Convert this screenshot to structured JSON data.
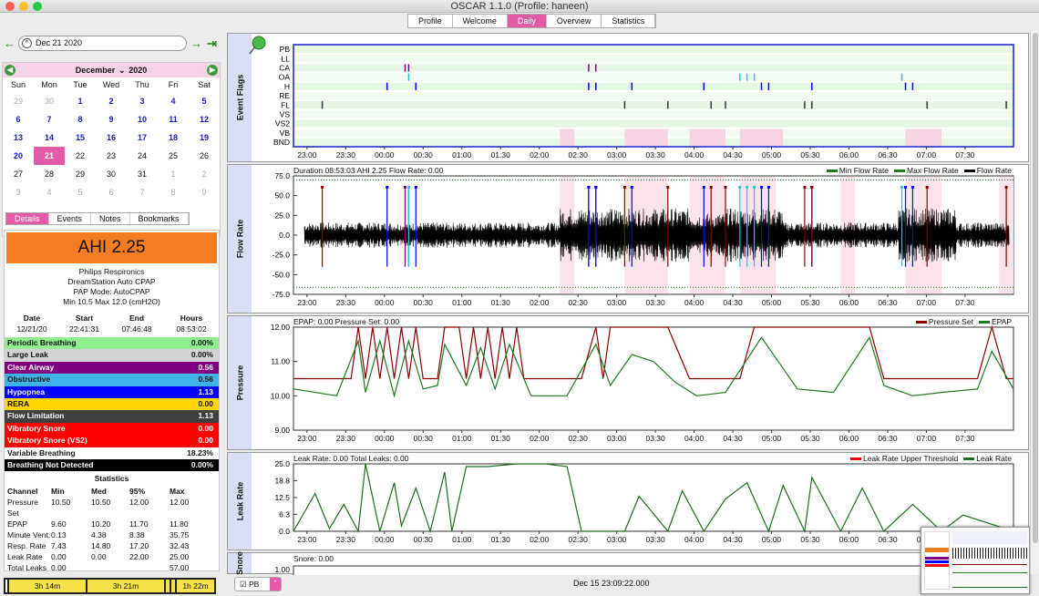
{
  "window": {
    "title": "OSCAR 1.1.0 (Profile: haneen)"
  },
  "tabs": [
    "Profile",
    "Welcome",
    "Daily",
    "Overview",
    "Statistics"
  ],
  "active_tab": "Daily",
  "nav": {
    "date_value": "Dec 21 2020",
    "prev_icon": "arrow-left-icon",
    "next_icon": "arrow-right-icon",
    "last_icon": "jump-end-icon"
  },
  "calendar": {
    "month": "December",
    "year": "2020",
    "dows": [
      "Sun",
      "Mon",
      "Tue",
      "Wed",
      "Thu",
      "Fri",
      "Sat"
    ],
    "days": [
      {
        "d": "29",
        "c": "out"
      },
      {
        "d": "30",
        "c": "out"
      },
      {
        "d": "1",
        "c": "blue"
      },
      {
        "d": "2",
        "c": "blue"
      },
      {
        "d": "3",
        "c": "blue"
      },
      {
        "d": "4",
        "c": "blue"
      },
      {
        "d": "5",
        "c": "blue"
      },
      {
        "d": "6",
        "c": "blue"
      },
      {
        "d": "7",
        "c": "blue"
      },
      {
        "d": "8",
        "c": "blue"
      },
      {
        "d": "9",
        "c": "blue"
      },
      {
        "d": "10",
        "c": "blue"
      },
      {
        "d": "11",
        "c": "blue"
      },
      {
        "d": "12",
        "c": "blue"
      },
      {
        "d": "13",
        "c": "blue"
      },
      {
        "d": "14",
        "c": "blue"
      },
      {
        "d": "15",
        "c": "blue"
      },
      {
        "d": "16",
        "c": "blue"
      },
      {
        "d": "17",
        "c": "blue"
      },
      {
        "d": "18",
        "c": "blue"
      },
      {
        "d": "19",
        "c": "blue"
      },
      {
        "d": "20",
        "c": "blue"
      },
      {
        "d": "21",
        "c": "sel"
      },
      {
        "d": "22",
        "c": "black"
      },
      {
        "d": "23",
        "c": "black"
      },
      {
        "d": "24",
        "c": "black"
      },
      {
        "d": "25",
        "c": "black"
      },
      {
        "d": "26",
        "c": "black"
      },
      {
        "d": "27",
        "c": "black"
      },
      {
        "d": "28",
        "c": "black"
      },
      {
        "d": "29",
        "c": "black"
      },
      {
        "d": "30",
        "c": "black"
      },
      {
        "d": "31",
        "c": "black"
      },
      {
        "d": "1",
        "c": "out"
      },
      {
        "d": "2",
        "c": "out"
      },
      {
        "d": "3",
        "c": "out"
      },
      {
        "d": "4",
        "c": "out"
      },
      {
        "d": "5",
        "c": "out"
      },
      {
        "d": "6",
        "c": "out"
      },
      {
        "d": "7",
        "c": "out"
      },
      {
        "d": "8",
        "c": "out"
      },
      {
        "d": "9",
        "c": "out"
      }
    ]
  },
  "subtabs": [
    "Details",
    "Events",
    "Notes",
    "Bookmarks"
  ],
  "details": {
    "ahi": "AHI 2.25",
    "machine": [
      "Philips Respironics",
      "DreamStation Auto CPAP",
      "PAP Mode: AutoCPAP",
      "Min 10.5 Max 12.0 (cmH2O)"
    ],
    "session_headers": [
      "Date",
      "Start",
      "End",
      "Hours"
    ],
    "session": [
      "12/21/20",
      "22:41:31",
      "07:46:48",
      "08:53:02"
    ],
    "indices": [
      {
        "name": "Periodic Breathing",
        "value": "0.00%",
        "bg": "#90ee90",
        "fg": "#111"
      },
      {
        "name": "Large Leak",
        "value": "0.00%",
        "bg": "#d3d3d3",
        "fg": "#111"
      },
      {
        "name": "Clear Airway",
        "value": "0.56",
        "bg": "#800080",
        "fg": "#fff"
      },
      {
        "name": "Obstructive",
        "value": "0.56",
        "bg": "#3fb2e6",
        "fg": "#111"
      },
      {
        "name": "Hypopnea",
        "value": "1.13",
        "bg": "#0000ff",
        "fg": "#fff"
      },
      {
        "name": "RERA",
        "value": "0.00",
        "bg": "#ffd700",
        "fg": "#111"
      },
      {
        "name": "Flow Limitation",
        "value": "1.13",
        "bg": "#404040",
        "fg": "#fff"
      },
      {
        "name": "Vibratory Snore",
        "value": "0.00",
        "bg": "#ff0000",
        "fg": "#fff"
      },
      {
        "name": "Vibratory Snore (VS2)",
        "value": "0.00",
        "bg": "#ff0000",
        "fg": "#fff"
      },
      {
        "name": "Variable Breathing",
        "value": "18.23%",
        "bg": "#ffffff",
        "fg": "#111"
      },
      {
        "name": "Breathing Not Detected",
        "value": "0.00%",
        "bg": "#000000",
        "fg": "#fff"
      }
    ],
    "stats_title": "Statistics",
    "stats_headers": [
      "Channel",
      "Min",
      "Med",
      "95%",
      "Max"
    ],
    "stats": [
      [
        "Pressure Set",
        "10.50",
        "10.50",
        "12.00",
        "12.00"
      ],
      [
        "EPAP",
        "9.60",
        "10.20",
        "11.70",
        "11.80"
      ],
      [
        "Minute Vent.",
        "0.13",
        "4.38",
        "8.38",
        "35.75"
      ],
      [
        "Resp. Rate",
        "7.43",
        "14.80",
        "17.20",
        "32.43"
      ],
      [
        "Leak Rate",
        "0.00",
        "0.00",
        "22.00",
        "25.00"
      ],
      [
        "Total Leaks",
        "0.00",
        "",
        "",
        "57.00"
      ]
    ],
    "bottom_segments": [
      "3h 14m",
      "3h 21m",
      "1h 22m"
    ]
  },
  "x_ticks": [
    "23:00",
    "23:30",
    "00:00",
    "00:30",
    "01:00",
    "01:30",
    "02:00",
    "02:30",
    "03:00",
    "03:30",
    "04:00",
    "04:30",
    "05:00",
    "05:30",
    "06:00",
    "06:30",
    "07:00",
    "07:30"
  ],
  "chart_data": [
    {
      "type": "event-flags",
      "title": "Event Flags",
      "rows": [
        "PB",
        "LL",
        "CA",
        "OA",
        "H",
        "RE",
        "FL",
        "VS",
        "VS2",
        "VB",
        "BND"
      ],
      "events": {
        "CA": [
          0.155,
          0.16,
          0.41,
          0.42
        ],
        "OA": [
          0.16,
          0.62,
          0.63,
          0.64,
          0.845
        ],
        "H": [
          0.13,
          0.17,
          0.41,
          0.42,
          0.47,
          0.57,
          0.65,
          0.66,
          0.72,
          0.85,
          0.86
        ],
        "FL": [
          0.04,
          0.46,
          0.52,
          0.58,
          0.6,
          0.71,
          0.72,
          0.88,
          0.99
        ]
      }
    },
    {
      "type": "line",
      "title": "Flow Rate",
      "caption": "Duration 08:53:03 AHI 2.25 Flow Rate: 0.00",
      "legend": [
        "Min Flow Rate",
        "Max Flow Rate",
        "Flow Rate"
      ],
      "ylim": [
        -75,
        75
      ],
      "yticks": [
        "75.0",
        "50.0",
        "25.0",
        "0.0",
        "-25.0",
        "-50.0",
        "-75.0"
      ]
    },
    {
      "type": "line",
      "title": "Pressure",
      "caption": "EPAP: 0.00 Pressure Set: 0.00",
      "legend": [
        "Pressure Set",
        "EPAP"
      ],
      "ylim": [
        9,
        12
      ],
      "yticks": [
        "12.00",
        "11.00",
        "10.00",
        "9.00"
      ],
      "series": [
        {
          "name": "Pressure Set",
          "x": [
            0,
            0.08,
            0.09,
            0.1,
            0.11,
            0.12,
            0.13,
            0.14,
            0.15,
            0.16,
            0.17,
            0.18,
            0.2,
            0.21,
            0.23,
            0.24,
            0.25,
            0.26,
            0.27,
            0.28,
            0.29,
            0.3,
            0.31,
            0.32,
            0.33,
            0.4,
            0.42,
            0.43,
            0.44,
            0.52,
            0.55,
            0.62,
            0.64,
            0.66,
            0.8,
            0.82,
            0.84,
            0.86,
            0.9,
            0.95,
            0.97,
            0.99,
            1
          ],
          "y": [
            10.5,
            10.5,
            12,
            10.5,
            12,
            10.5,
            12,
            10.5,
            12,
            10.5,
            12,
            10.5,
            10.5,
            12,
            12,
            10.5,
            12,
            10.5,
            12,
            10.5,
            12,
            10.5,
            12,
            10.5,
            10.5,
            10.5,
            12,
            10.5,
            12,
            12,
            10.5,
            10.5,
            12,
            12,
            12,
            10.5,
            10.5,
            10.5,
            10.5,
            10.5,
            12,
            10.5,
            10.5
          ]
        },
        {
          "name": "EPAP",
          "x": [
            0,
            0.06,
            0.09,
            0.1,
            0.12,
            0.14,
            0.16,
            0.18,
            0.2,
            0.21,
            0.24,
            0.26,
            0.28,
            0.3,
            0.33,
            0.38,
            0.42,
            0.44,
            0.47,
            0.5,
            0.53,
            0.56,
            0.6,
            0.65,
            0.7,
            0.75,
            0.8,
            0.82,
            0.86,
            0.9,
            0.95,
            0.97,
            1
          ],
          "y": [
            10.2,
            10.0,
            11.6,
            10.1,
            11.6,
            10.0,
            11.6,
            10.2,
            10.3,
            11.5,
            10.3,
            11.4,
            10.2,
            11.5,
            10.0,
            10.0,
            11.5,
            10.3,
            11.2,
            11.0,
            10.4,
            10.0,
            10.1,
            11.7,
            10.2,
            10.1,
            11.7,
            10.3,
            10.0,
            10.1,
            10.2,
            11.3,
            10.2
          ]
        }
      ]
    },
    {
      "type": "line",
      "title": "Leak Rate",
      "caption": "Leak Rate: 0.00 Total Leaks: 0.00",
      "legend": [
        "Leak Rate Upper Threshold",
        "Leak Rate"
      ],
      "ylim": [
        0,
        25
      ],
      "yticks": [
        "25.0",
        "18.8",
        "12.5",
        "6.3",
        "0.0"
      ],
      "series": [
        {
          "name": "Leak Rate",
          "x": [
            0,
            0.03,
            0.05,
            0.07,
            0.09,
            0.1,
            0.12,
            0.14,
            0.15,
            0.17,
            0.19,
            0.21,
            0.22,
            0.24,
            0.27,
            0.31,
            0.35,
            0.38,
            0.4,
            0.46,
            0.48,
            0.52,
            0.54,
            0.57,
            0.6,
            0.63,
            0.66,
            0.68,
            0.71,
            0.72,
            0.76,
            0.79,
            0.82,
            0.86,
            0.9,
            0.93,
            1
          ],
          "y": [
            0,
            14,
            1,
            10,
            0,
            25,
            0,
            18,
            2,
            16,
            0,
            22,
            0,
            24,
            24,
            25,
            25,
            24,
            0,
            0,
            13,
            0,
            15,
            0,
            12,
            18,
            0,
            17,
            0,
            20,
            0,
            16,
            0,
            10,
            0,
            6,
            0
          ]
        }
      ]
    },
    {
      "type": "line",
      "title": "Snore",
      "caption": "Snore: 0.00",
      "yticks": [
        "1.00"
      ]
    }
  ],
  "status": {
    "pb_label": "PB",
    "timestamp": "Dec 15 23:09:22.000"
  },
  "colors": {
    "accent": "#e25aa8",
    "flow": "#000000",
    "pressure_set": "#8b0000",
    "epap": "#1e7a1e",
    "leak": "#1e6e1e",
    "threshold": "#ff0000"
  }
}
